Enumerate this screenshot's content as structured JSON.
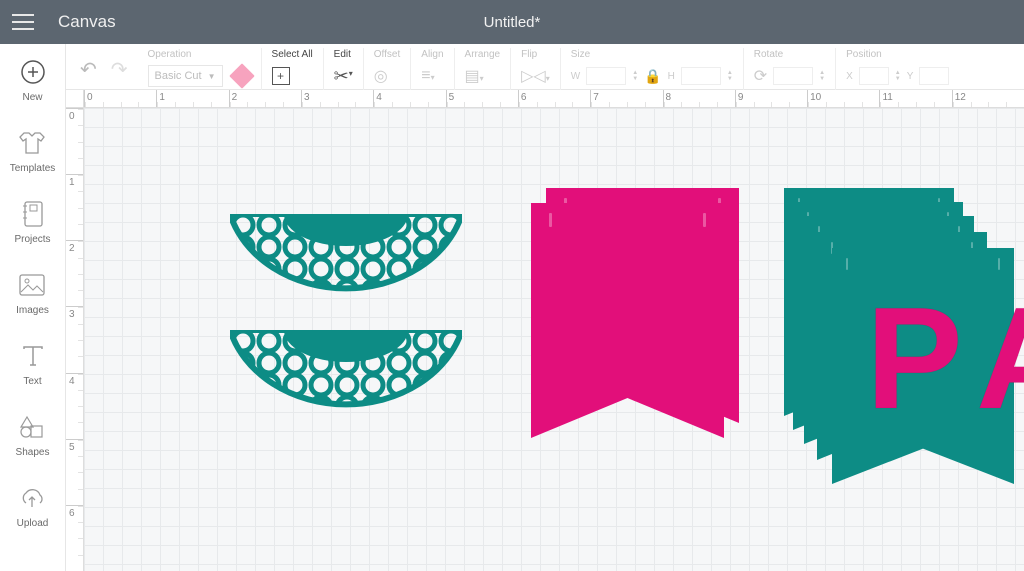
{
  "app": {
    "title": "Canvas",
    "document_title": "Untitled*"
  },
  "sidebar": {
    "items": [
      {
        "label": "New",
        "icon": "plus-circle-icon"
      },
      {
        "label": "Templates",
        "icon": "tshirt-icon"
      },
      {
        "label": "Projects",
        "icon": "notebook-icon"
      },
      {
        "label": "Images",
        "icon": "image-icon"
      },
      {
        "label": "Text",
        "icon": "text-icon"
      },
      {
        "label": "Shapes",
        "icon": "shapes-icon"
      },
      {
        "label": "Upload",
        "icon": "cloud-upload-icon"
      }
    ]
  },
  "toolbar": {
    "operation": {
      "header": "Operation",
      "value": "Basic Cut"
    },
    "select_all": {
      "header": "Select All"
    },
    "edit": {
      "header": "Edit"
    },
    "offset": {
      "header": "Offset"
    },
    "align": {
      "header": "Align"
    },
    "arrange": {
      "header": "Arrange"
    },
    "flip": {
      "header": "Flip"
    },
    "size": {
      "header": "Size",
      "w_label": "W",
      "h_label": "H",
      "w": "",
      "h": ""
    },
    "rotate": {
      "header": "Rotate",
      "value": ""
    },
    "position": {
      "header": "Position",
      "x_label": "X",
      "y_label": "Y",
      "x": "",
      "y": ""
    }
  },
  "ruler": {
    "h": [
      "0",
      "1",
      "2",
      "3",
      "4",
      "5",
      "6",
      "7",
      "8",
      "9",
      "10",
      "11",
      "12"
    ],
    "v": [
      "0",
      "1",
      "2",
      "3",
      "4",
      "5",
      "6"
    ]
  },
  "canvas": {
    "colors": {
      "teal": "#0d8c85",
      "pink": "#e20f7a"
    },
    "letters": [
      "P",
      "A"
    ]
  }
}
